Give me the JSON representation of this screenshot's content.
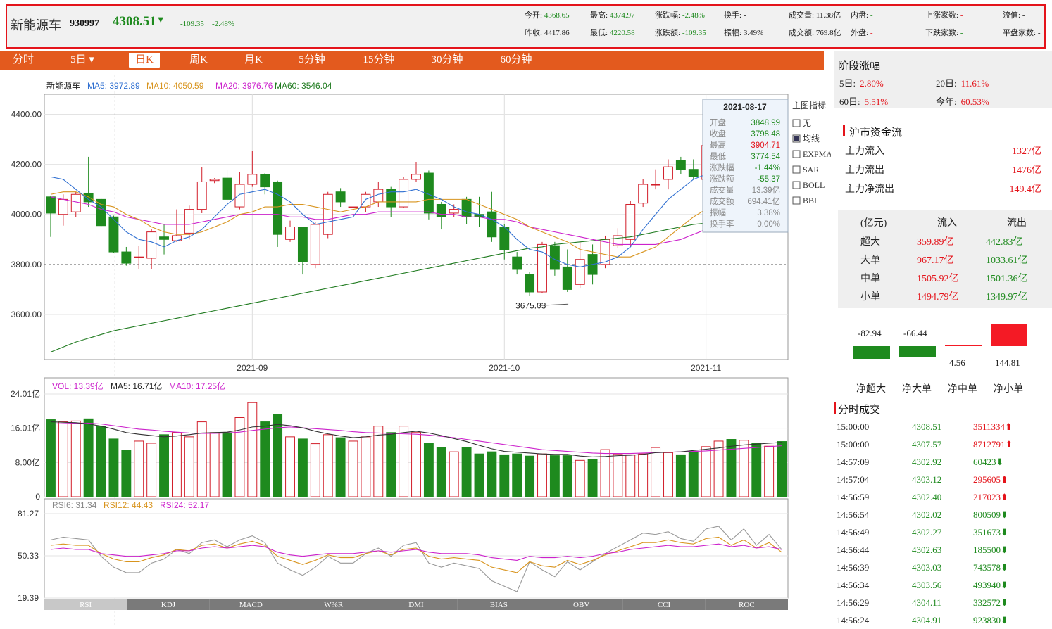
{
  "header": {
    "name": "新能源车",
    "code": "930997",
    "price": "4308.51",
    "price_arrow": "▼",
    "change": "-109.35",
    "change_pct": "-2.48%",
    "stats": [
      {
        "label": "今开:",
        "value": "4368.65",
        "color": "g"
      },
      {
        "label": "最高:",
        "value": "4374.97",
        "color": "g"
      },
      {
        "label": "涨跌幅:",
        "value": "-2.48%",
        "color": "g"
      },
      {
        "label": "换手:",
        "value": "-",
        "color": ""
      },
      {
        "label": "成交量:",
        "value": "11.38亿",
        "color": ""
      },
      {
        "label": "内盘:",
        "value": "-",
        "color": "g"
      },
      {
        "label": "上涨家数:",
        "value": "-",
        "color": "r"
      },
      {
        "label": "流值:",
        "value": "-",
        "color": ""
      },
      {
        "label": "昨收:",
        "value": "4417.86",
        "color": ""
      },
      {
        "label": "最低:",
        "value": "4220.58",
        "color": "g"
      },
      {
        "label": "涨跌额:",
        "value": "-109.35",
        "color": "g"
      },
      {
        "label": "振幅:",
        "value": "3.49%",
        "color": ""
      },
      {
        "label": "成交额:",
        "value": "769.8亿",
        "color": ""
      },
      {
        "label": "外盘:",
        "value": "-",
        "color": "r"
      },
      {
        "label": "下跌家数:",
        "value": "-",
        "color": "g"
      },
      {
        "label": "平盘家数:",
        "value": "-",
        "color": ""
      }
    ]
  },
  "tabs": [
    "分时",
    "5日 ▾",
    "日K",
    "周K",
    "月K",
    "5分钟",
    "15分钟",
    "30分钟",
    "60分钟"
  ],
  "active_tab": "日K",
  "main_legend": {
    "name": "新能源车",
    "ma5": "MA5: 3972.89",
    "ma10": "MA10: 4050.59",
    "ma20": "MA20: 3976.76",
    "ma60": "MA60: 3546.04"
  },
  "vol_legend": {
    "vol": "VOL: 13.39亿",
    "ma5": "MA5: 16.71亿",
    "ma10": "MA10: 17.25亿"
  },
  "rsi_legend": {
    "rsi6": "RSI6: 31.34",
    "rsi12": "RSI12: 44.43",
    "rsi24": "RSI24: 52.17"
  },
  "indicator_panel": {
    "title": "主图指标",
    "options": [
      "无",
      "均线",
      "EXPMA",
      "SAR",
      "BOLL",
      "BBI"
    ],
    "selected": "均线"
  },
  "tooltip": {
    "date": "2021-08-17",
    "rows": [
      {
        "k": "开盘",
        "v": "3848.99",
        "c": "g"
      },
      {
        "k": "收盘",
        "v": "3798.48",
        "c": "g"
      },
      {
        "k": "最高",
        "v": "3904.71",
        "c": "r"
      },
      {
        "k": "最低",
        "v": "3774.54",
        "c": "g"
      },
      {
        "k": "涨跌幅",
        "v": "-1.44%",
        "c": "g"
      },
      {
        "k": "涨跌额",
        "v": "-55.37",
        "c": "g"
      },
      {
        "k": "成交量",
        "v": "13.39亿",
        "c": ""
      },
      {
        "k": "成交额",
        "v": "694.41亿",
        "c": ""
      },
      {
        "k": "振幅",
        "v": "3.38%",
        "c": ""
      },
      {
        "k": "换手率",
        "v": "0.00%",
        "c": ""
      }
    ]
  },
  "bottom_tabs": [
    "RSI",
    "KDJ",
    "MACD",
    "W%R",
    "DMI",
    "BIAS",
    "OBV",
    "CCI",
    "ROC"
  ],
  "stage": {
    "title": "阶段涨幅",
    "items": [
      {
        "k": "5日:",
        "v": "2.80%"
      },
      {
        "k": "20日:",
        "v": "11.61%"
      },
      {
        "k": "60日:",
        "v": "5.51%"
      },
      {
        "k": "今年:",
        "v": "60.53%"
      }
    ]
  },
  "fund": {
    "title": "沪市资金流",
    "rows": [
      {
        "k": "主力流入",
        "v": "1327亿"
      },
      {
        "k": "主力流出",
        "v": "1476亿"
      },
      {
        "k": "主力净流出",
        "v": "149.4亿"
      }
    ],
    "table_head": [
      "(亿元)",
      "流入",
      "流出"
    ],
    "table": [
      {
        "k": "超大",
        "in": "359.89亿",
        "out": "442.83亿"
      },
      {
        "k": "大单",
        "in": "967.17亿",
        "out": "1033.61亿"
      },
      {
        "k": "中单",
        "in": "1505.92亿",
        "out": "1501.36亿"
      },
      {
        "k": "小单",
        "in": "1494.79亿",
        "out": "1349.97亿"
      }
    ],
    "net": [
      {
        "label": "净超大",
        "value": -82.94,
        "text": "-82.94"
      },
      {
        "label": "净大单",
        "value": -66.44,
        "text": "-66.44"
      },
      {
        "label": "净中单",
        "value": 4.56,
        "text": "4.56"
      },
      {
        "label": "净小单",
        "value": 144.81,
        "text": "144.81"
      }
    ]
  },
  "ticks": {
    "title": "分时成交",
    "rows": [
      {
        "t": "15:00:00",
        "p": "4308.51",
        "v": "3511334",
        "d": "up"
      },
      {
        "t": "15:00:00",
        "p": "4307.57",
        "v": "8712791",
        "d": "up"
      },
      {
        "t": "14:57:09",
        "p": "4302.92",
        "v": "60423",
        "d": "down"
      },
      {
        "t": "14:57:04",
        "p": "4303.12",
        "v": "295605",
        "d": "up"
      },
      {
        "t": "14:56:59",
        "p": "4302.40",
        "v": "217023",
        "d": "up"
      },
      {
        "t": "14:56:54",
        "p": "4302.02",
        "v": "800509",
        "d": "down"
      },
      {
        "t": "14:56:49",
        "p": "4302.27",
        "v": "351673",
        "d": "down"
      },
      {
        "t": "14:56:44",
        "p": "4302.63",
        "v": "185500",
        "d": "down"
      },
      {
        "t": "14:56:39",
        "p": "4303.03",
        "v": "743578",
        "d": "down"
      },
      {
        "t": "14:56:34",
        "p": "4303.56",
        "v": "493940",
        "d": "down"
      },
      {
        "t": "14:56:29",
        "p": "4304.11",
        "v": "332572",
        "d": "down"
      },
      {
        "t": "14:56:24",
        "p": "4304.91",
        "v": "923830",
        "d": "down"
      }
    ]
  },
  "chart_data": {
    "type": "candlestick",
    "y_ticks": [
      "4400.00",
      "4200.00",
      "4000.00",
      "3800.00",
      "3600.00"
    ],
    "ylim": [
      3420,
      4480
    ],
    "x_labels": [
      {
        "i": 16,
        "text": "2021-09"
      },
      {
        "i": 36,
        "text": "2021-10"
      },
      {
        "i": 52,
        "text": "2021-11"
      }
    ],
    "min_label": "3675.03",
    "candles": [
      [
        4070,
        4005,
        4075,
        3910
      ],
      [
        4000,
        4060,
        4080,
        3955
      ],
      [
        4010,
        4080,
        4090,
        3990
      ],
      [
        4085,
        4050,
        4230,
        4030
      ],
      [
        4060,
        3955,
        4065,
        3950
      ],
      [
        3990,
        3850,
        3995,
        3845
      ],
      [
        3850,
        3805,
        3870,
        3795
      ],
      [
        3830,
        3830,
        3875,
        3780
      ],
      [
        3825,
        3930,
        3940,
        3780
      ],
      [
        3910,
        3900,
        3960,
        3840
      ],
      [
        3895,
        3915,
        4020,
        3890
      ],
      [
        3925,
        4020,
        4035,
        3900
      ],
      [
        4020,
        4130,
        4190,
        4005
      ],
      [
        4135,
        4140,
        4145,
        4125
      ],
      [
        4145,
        4060,
        4180,
        4040
      ],
      [
        4030,
        4120,
        4170,
        4020
      ],
      [
        4120,
        4160,
        4255,
        4110
      ],
      [
        4160,
        4110,
        4165,
        4080
      ],
      [
        4130,
        3920,
        4135,
        3870
      ],
      [
        3900,
        3950,
        3975,
        3890
      ],
      [
        3950,
        3810,
        3950,
        3760
      ],
      [
        3800,
        3960,
        3970,
        3785
      ],
      [
        3920,
        4080,
        4090,
        3905
      ],
      [
        4090,
        4050,
        4105,
        4030
      ],
      [
        4030,
        4030,
        4040,
        4020
      ],
      [
        4030,
        4080,
        4090,
        4010
      ],
      [
        4050,
        4100,
        4130,
        4030
      ],
      [
        4100,
        4030,
        4110,
        3990
      ],
      [
        4030,
        4140,
        4150,
        4025
      ],
      [
        4140,
        4160,
        4210,
        4130
      ],
      [
        4165,
        4005,
        4175,
        3980
      ],
      [
        4040,
        3990,
        4050,
        3940
      ],
      [
        4005,
        4020,
        4040,
        3990
      ],
      [
        4060,
        3990,
        4070,
        3960
      ],
      [
        4000,
        3990,
        4070,
        3950
      ],
      [
        4010,
        3910,
        4090,
        3890
      ],
      [
        3950,
        3860,
        3960,
        3820
      ],
      [
        3830,
        3780,
        3850,
        3760
      ],
      [
        3760,
        3690,
        3770,
        3675
      ],
      [
        3690,
        3880,
        3890,
        3685
      ],
      [
        3875,
        3780,
        3890,
        3755
      ],
      [
        3790,
        3700,
        3860,
        3690
      ],
      [
        3720,
        3820,
        3890,
        3705
      ],
      [
        3840,
        3760,
        3880,
        3720
      ],
      [
        3800,
        3900,
        3915,
        3785
      ],
      [
        3875,
        3915,
        3945,
        3865
      ],
      [
        3900,
        4040,
        4055,
        3870
      ],
      [
        4045,
        4120,
        4140,
        4030
      ],
      [
        4120,
        4120,
        4180,
        4100
      ],
      [
        4140,
        4190,
        4220,
        4100
      ],
      [
        4215,
        4180,
        4230,
        4160
      ],
      [
        4180,
        4150,
        4220,
        4140
      ],
      [
        4140,
        4275,
        4300,
        4130
      ],
      [
        4280,
        4380,
        4395,
        4270
      ],
      [
        4370,
        4240,
        4395,
        4230
      ],
      [
        4250,
        4360,
        4415,
        4240
      ],
      [
        4340,
        4270,
        4355,
        4245
      ],
      [
        4270,
        4320,
        4340,
        4190
      ],
      [
        4320,
        4250,
        4330,
        4200
      ]
    ],
    "ma5": [
      4150,
      4140,
      4100,
      4060,
      4030,
      3980,
      3930,
      3900,
      3890,
      3870,
      3895,
      3910,
      3940,
      3990,
      4040,
      4080,
      4090,
      4100,
      4080,
      4050,
      4000,
      3960,
      3970,
      3980,
      3990,
      4060,
      4080,
      4090,
      4090,
      4100,
      4080,
      4060,
      4030,
      4010,
      4000,
      3980,
      3950,
      3900,
      3860,
      3850,
      3820,
      3800,
      3790,
      3800,
      3810,
      3830,
      3870,
      3940,
      4000,
      4060,
      4100,
      4140,
      4160,
      4200,
      4240,
      4270,
      4300,
      4300,
      4300
    ],
    "ma10": [
      4080,
      4090,
      4090,
      4070,
      4040,
      4030,
      4000,
      3980,
      3950,
      3930,
      3920,
      3920,
      3930,
      3950,
      3970,
      4000,
      4010,
      4030,
      4030,
      4040,
      4040,
      4030,
      4020,
      4010,
      4020,
      4030,
      4050,
      4050,
      4050,
      4050,
      4060,
      4060,
      4060,
      4060,
      4040,
      4020,
      4000,
      3980,
      3950,
      3930,
      3910,
      3890,
      3860,
      3850,
      3840,
      3830,
      3830,
      3850,
      3870,
      3910,
      3950,
      3990,
      4020,
      4060,
      4110,
      4150,
      4190,
      4220,
      4250
    ],
    "ma20": [
      4070,
      4060,
      4050,
      4040,
      4020,
      4010,
      3990,
      3980,
      3970,
      3960,
      3960,
      3960,
      3970,
      3980,
      3990,
      4000,
      4000,
      4000,
      4000,
      3990,
      3990,
      3980,
      3980,
      3990,
      4000,
      4000,
      4010,
      4010,
      4010,
      4010,
      4010,
      4000,
      4000,
      3990,
      3990,
      3980,
      3980,
      3970,
      3950,
      3940,
      3930,
      3920,
      3910,
      3900,
      3890,
      3880,
      3880,
      3880,
      3880,
      3890,
      3900,
      3920,
      3940,
      3960,
      3980,
      4000,
      4020,
      4040,
      4060
    ],
    "ma60": [
      3450,
      3470,
      3490,
      3505,
      3520,
      3535,
      3545,
      3555,
      3565,
      3575,
      3585,
      3595,
      3605,
      3615,
      3625,
      3635,
      3645,
      3655,
      3665,
      3675,
      3685,
      3695,
      3705,
      3715,
      3725,
      3735,
      3745,
      3755,
      3765,
      3775,
      3785,
      3795,
      3805,
      3815,
      3825,
      3835,
      3845,
      3855,
      3865,
      3870,
      3880,
      3885,
      3890,
      3895,
      3900,
      3905,
      3910,
      3920,
      3930,
      3940,
      3950,
      3960,
      3965,
      3970,
      3980,
      3990,
      4000,
      4010,
      4020
    ],
    "vol_ticks": [
      "24.01亿",
      "16.01亿",
      "8.00亿",
      "0"
    ],
    "vol_max": 24.01,
    "volume": [
      18,
      17.5,
      17.7,
      18.2,
      16.5,
      13.5,
      10.8,
      13,
      12.5,
      14.5,
      15,
      14,
      17.5,
      15,
      15,
      18.5,
      22,
      17.5,
      19.2,
      14,
      13.5,
      12.4,
      14.5,
      13.8,
      13,
      14,
      16.5,
      15,
      16.5,
      15,
      12.5,
      11.5,
      10.5,
      11.5,
      10,
      10.5,
      9.8,
      10,
      9.5,
      10,
      9.6,
      9.6,
      8.5,
      8.8,
      11,
      10,
      9.8,
      10,
      11.5,
      10.3,
      9.8,
      10.5,
      11.7,
      13,
      13.4,
      13.2,
      12.5,
      11.8,
      12.9
    ],
    "vol_ma5": [
      17.5,
      17.4,
      17.3,
      17.0,
      16.5,
      15.8,
      15.0,
      14.6,
      14.3,
      14.0,
      14.2,
      14.5,
      14.9,
      15.0,
      15.1,
      15.6,
      16.3,
      16.5,
      16.9,
      16.6,
      16.1,
      15.3,
      14.7,
      14.2,
      13.8,
      14.0,
      14.4,
      14.6,
      15.0,
      15.3,
      14.9,
      14.3,
      13.6,
      12.9,
      12.0,
      11.2,
      10.6,
      10.4,
      10.2,
      10.0,
      9.9,
      9.9,
      9.5,
      9.3,
      9.4,
      9.6,
      9.7,
      9.9,
      10.3,
      10.4,
      10.5,
      10.8,
      11.1,
      11.4,
      11.8,
      12.1,
      12.3,
      12.5,
      12.7
    ],
    "vol_ma10": [
      17.0,
      17.1,
      17.2,
      17.2,
      17.0,
      16.6,
      16.2,
      15.8,
      15.6,
      15.3,
      15.1,
      14.9,
      14.8,
      14.8,
      14.9,
      15.1,
      15.5,
      15.8,
      16.1,
      16.3,
      16.1,
      15.9,
      15.7,
      15.5,
      15.2,
      15.0,
      14.9,
      14.8,
      14.7,
      14.6,
      14.4,
      14.1,
      13.8,
      13.4,
      13.0,
      12.6,
      12.2,
      11.8,
      11.4,
      11.0,
      10.8,
      10.6,
      10.4,
      10.2,
      10.1,
      10.1,
      10.1,
      10.2,
      10.3,
      10.4,
      10.5,
      10.6,
      10.7,
      10.9,
      11.1,
      11.3,
      11.5,
      11.7,
      11.9
    ],
    "rsi_ticks": [
      "81.27",
      "50.33",
      "19.39"
    ],
    "rsi_range": [
      19.39,
      81.27
    ],
    "rsi6": [
      62,
      64,
      63,
      62,
      50,
      42,
      38,
      38,
      45,
      48,
      55,
      52,
      60,
      62,
      57,
      62,
      65,
      60,
      45,
      40,
      36,
      42,
      50,
      45,
      45,
      52,
      56,
      50,
      58,
      60,
      45,
      42,
      45,
      43,
      41,
      32,
      28,
      24,
      46,
      40,
      35,
      46,
      40,
      46,
      52,
      57,
      62,
      67,
      66,
      68,
      63,
      61,
      70,
      72,
      62,
      70,
      58,
      66,
      55
    ],
    "rsi12": [
      58,
      59,
      58,
      58,
      52,
      48,
      46,
      46,
      49,
      51,
      55,
      54,
      58,
      59,
      56,
      59,
      61,
      58,
      50,
      47,
      44,
      47,
      51,
      49,
      49,
      52,
      54,
      51,
      55,
      56,
      50,
      48,
      49,
      48,
      47,
      42,
      40,
      38,
      46,
      43,
      42,
      47,
      44,
      47,
      51,
      54,
      57,
      60,
      60,
      62,
      60,
      59,
      63,
      64,
      58,
      62,
      56,
      60,
      53
    ],
    "rsi24": [
      55,
      56,
      55,
      55,
      52,
      51,
      50,
      50,
      51,
      52,
      54,
      54,
      56,
      57,
      56,
      57,
      58,
      57,
      53,
      51,
      50,
      51,
      52,
      52,
      52,
      53,
      54,
      53,
      54,
      55,
      53,
      52,
      52,
      52,
      51,
      49,
      48,
      47,
      50,
      49,
      49,
      50,
      49,
      50,
      52,
      53,
      55,
      56,
      57,
      58,
      57,
      57,
      58,
      59,
      57,
      58,
      56,
      57,
      55
    ]
  }
}
